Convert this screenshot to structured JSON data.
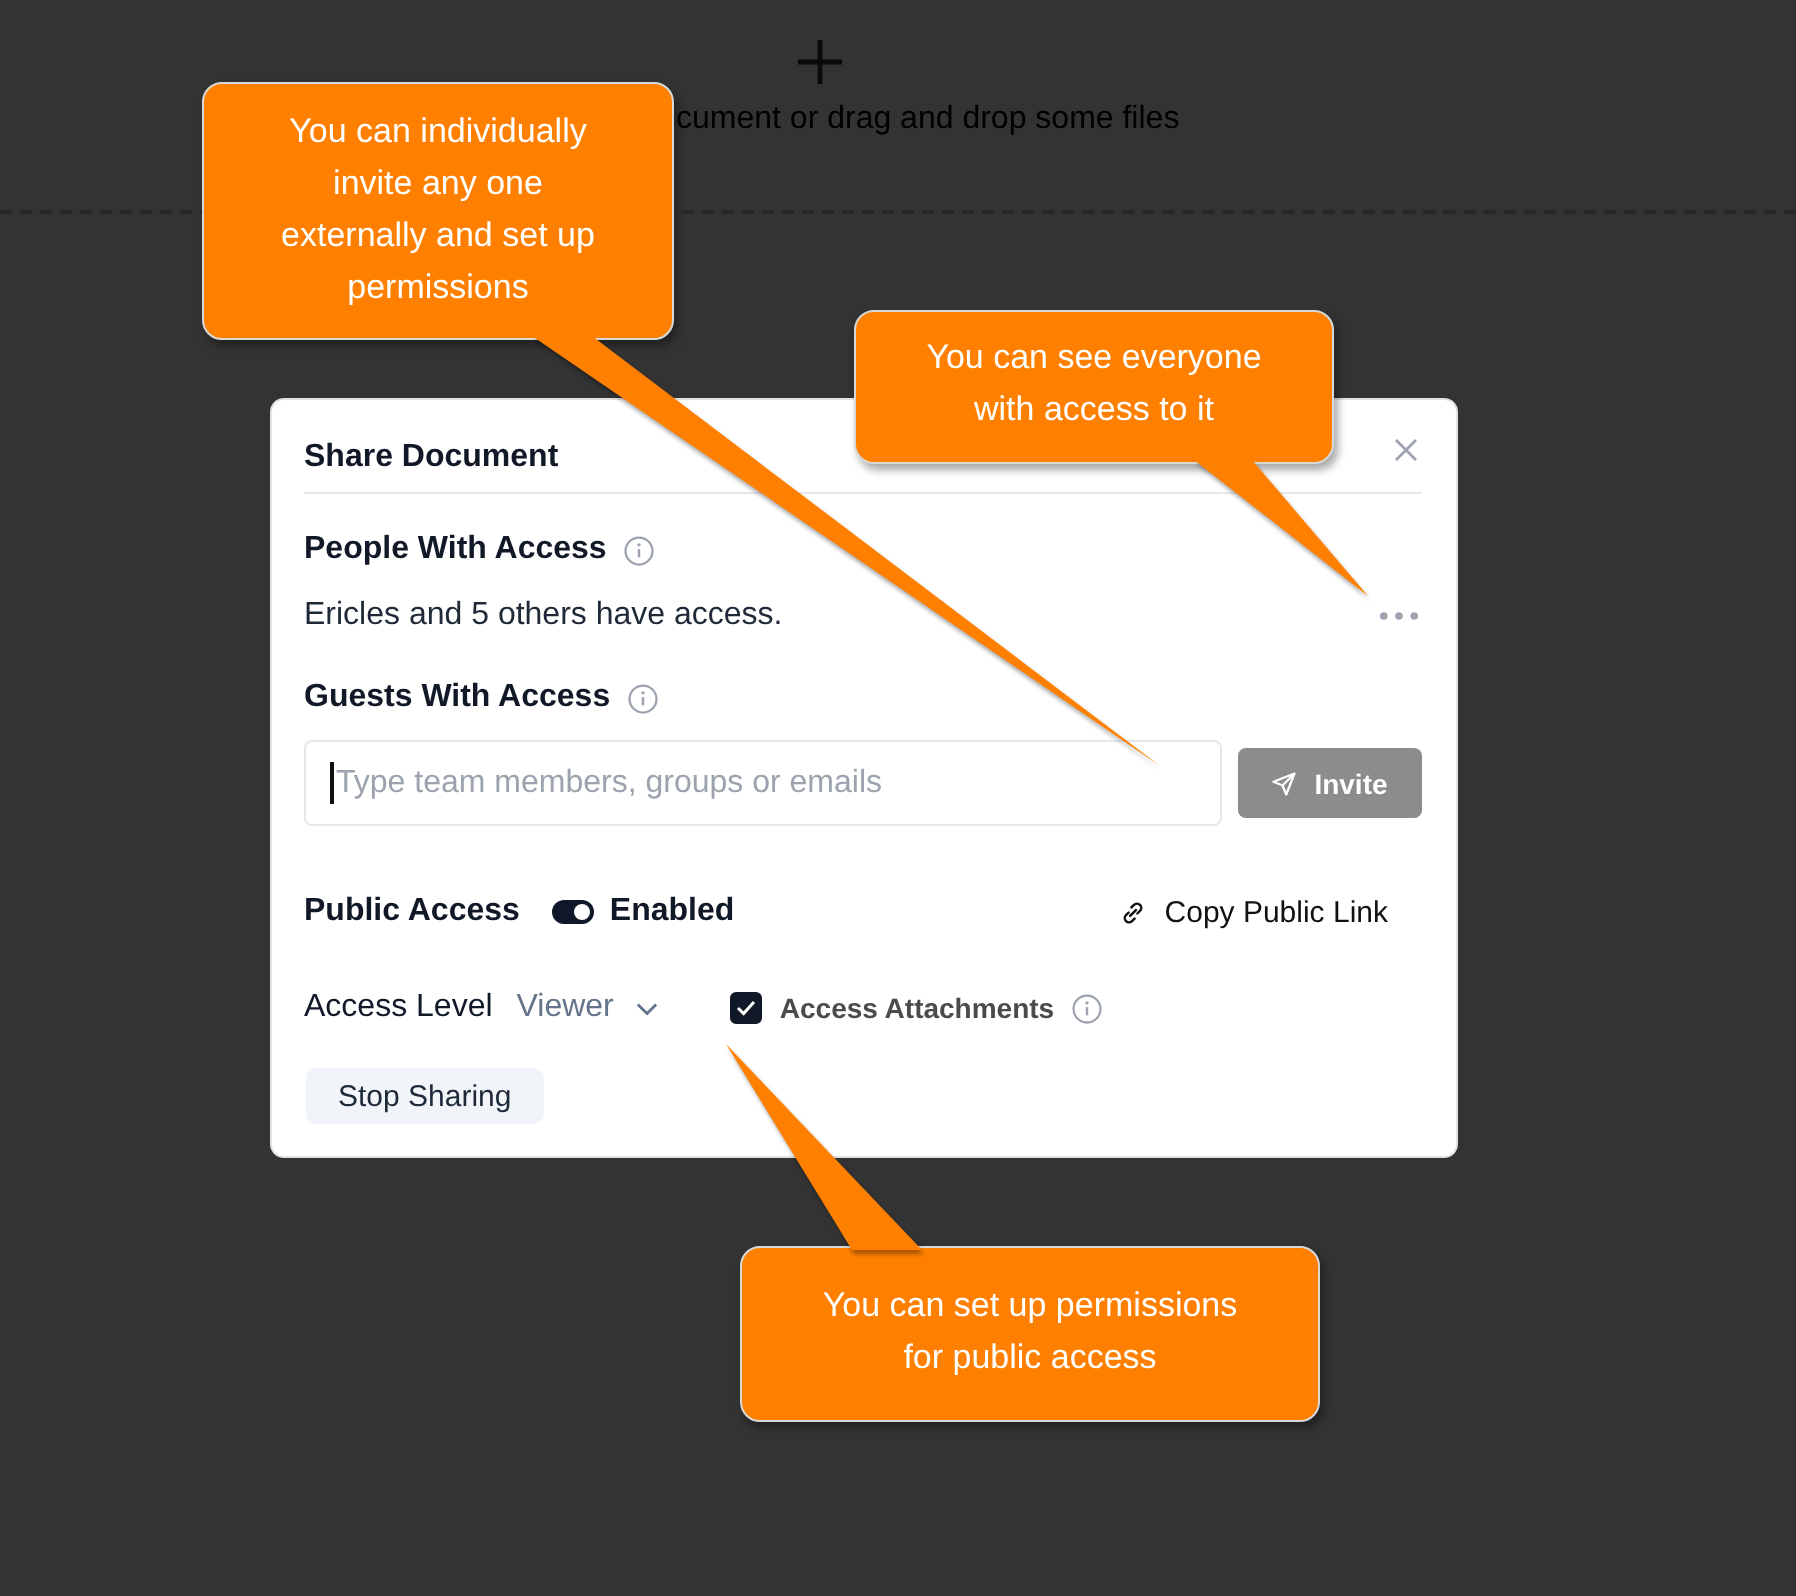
{
  "background": {
    "hint": "cument or drag and drop some files"
  },
  "dialog": {
    "title": "Share Document",
    "people": {
      "heading": "People With Access",
      "summary": "Ericles and 5 others have access."
    },
    "guests": {
      "heading": "Guests With Access",
      "field": {
        "placeholder": "Type team members, groups or emails",
        "focused": true
      },
      "invite": {
        "label": "Invite",
        "disabled": true
      }
    },
    "public_access": {
      "label": "Public Access",
      "enabled": true,
      "state_label": "Enabled",
      "copy_link": "Copy Public Link"
    },
    "access_level": {
      "label": "Access Level",
      "value": "Viewer"
    },
    "attachments": {
      "label": "Access Attachments",
      "checked": true
    },
    "stop_button": "Stop Sharing"
  },
  "callouts": [
    {
      "text": "You can individually\ninvite any one\nexternally and set up\npermissions"
    },
    {
      "text": "You can see everyone\nwith access to it"
    },
    {
      "text": "You can set up permissions\nfor public access"
    }
  ]
}
